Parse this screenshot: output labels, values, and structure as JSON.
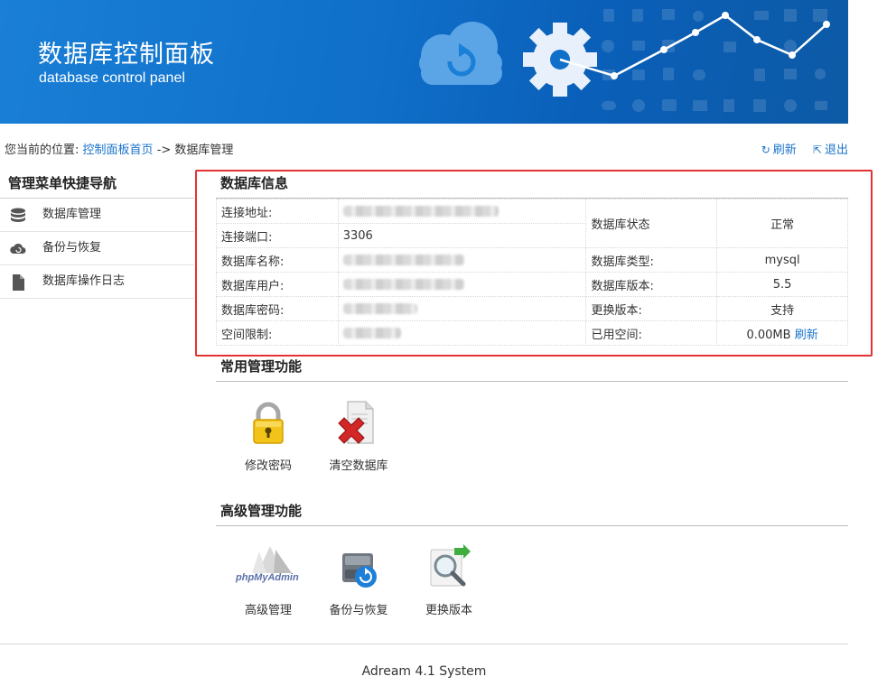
{
  "header": {
    "title": "数据库控制面板",
    "subtitle": "database control panel"
  },
  "breadcrumb": {
    "prefix": "您当前的位置:",
    "home_link": "控制面板首页",
    "separator": "->",
    "current": "数据库管理"
  },
  "top_actions": {
    "refresh_label": "刷新",
    "logout_label": "退出"
  },
  "sidebar": {
    "title": "管理菜单快捷导航",
    "items": [
      {
        "label": "数据库管理",
        "icon": "database-icon"
      },
      {
        "label": "备份与恢复",
        "icon": "cloud-icon"
      },
      {
        "label": "数据库操作日志",
        "icon": "document-icon"
      }
    ]
  },
  "db_info": {
    "title": "数据库信息",
    "address_label": "连接地址:",
    "port_label": "连接端口:",
    "port_value": "3306",
    "status_label": "数据库状态",
    "status_value": "正常",
    "name_label": "数据库名称:",
    "type_label": "数据库类型:",
    "type_value": "mysql",
    "user_label": "数据库用户:",
    "version_label": "数据库版本:",
    "version_value": "5.5",
    "password_label": "数据库密码:",
    "change_version_label": "更换版本:",
    "change_version_value": "支持",
    "space_limit_label": "空间限制:",
    "used_space_label": "已用空间:",
    "used_space_value": "0.00MB",
    "used_space_refresh": "刷新"
  },
  "common_functions": {
    "title": "常用管理功能",
    "items": [
      {
        "label": "修改密码",
        "icon": "padlock-icon"
      },
      {
        "label": "清空数据库",
        "icon": "clear-database-icon"
      }
    ]
  },
  "advanced_functions": {
    "title": "高级管理功能",
    "items": [
      {
        "label": "高级管理",
        "icon": "phpmyadmin-icon"
      },
      {
        "label": "备份与恢复",
        "icon": "backup-drive-icon"
      },
      {
        "label": "更换版本",
        "icon": "magnifier-icon"
      }
    ],
    "phpmyadmin_logo_text": "phpMyAdmin"
  },
  "footer": {
    "text": "Adream 4.1 System"
  },
  "colors": {
    "banner_blue": "#0f6fc9",
    "link_blue": "#1a73c9",
    "port_red": "#d62020",
    "ok_green": "#2f9a2f",
    "highlight_red": "#e33232"
  }
}
